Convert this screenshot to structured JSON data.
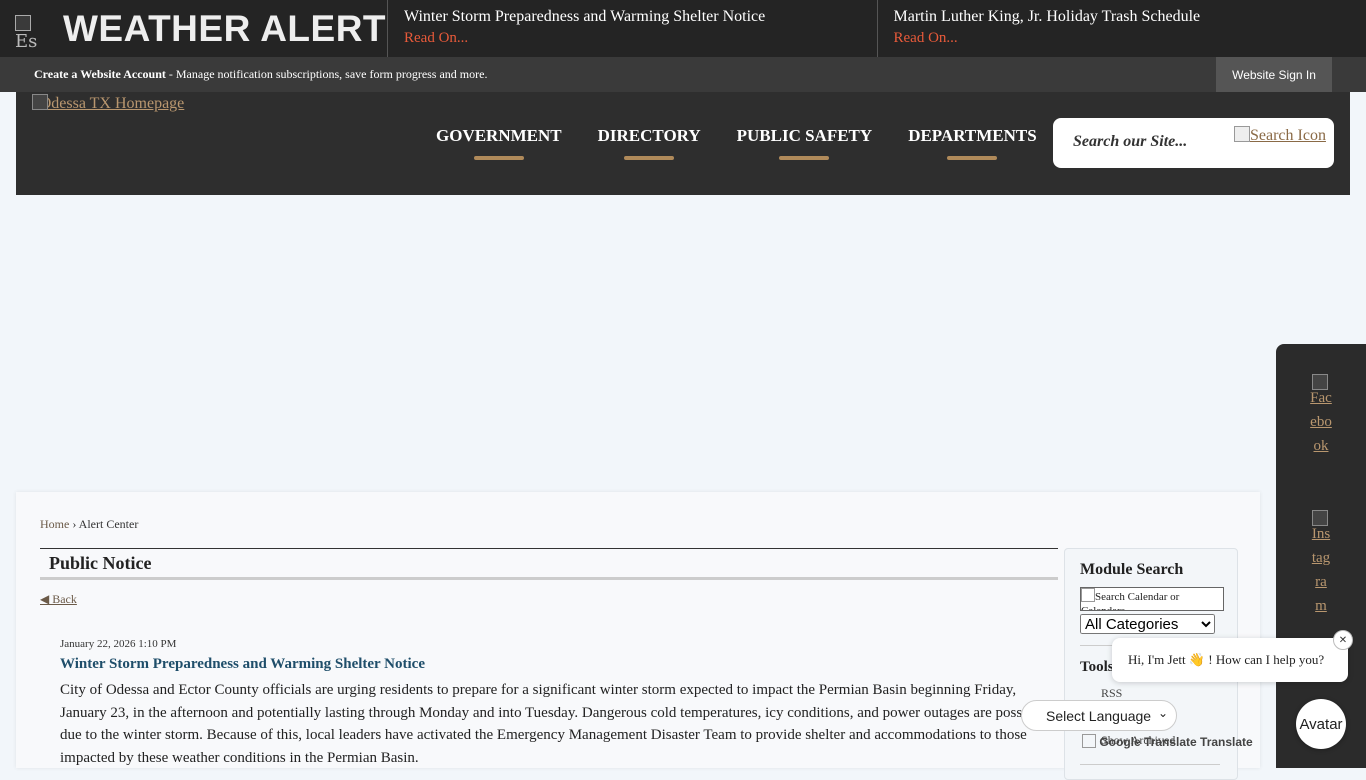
{
  "alert_bar": {
    "icon_alt": "Es",
    "title": "WEATHER ALERT",
    "items": [
      {
        "title": "Winter Storm Preparedness and Warming Shelter Notice",
        "link": "Read On..."
      },
      {
        "title": "Martin Luther King, Jr. Holiday Trash Schedule",
        "link": "Read On..."
      }
    ]
  },
  "account_bar": {
    "create_label": "Create a Website Account",
    "message": " - Manage notification subscriptions, save form progress and more.",
    "signin_label": "Website Sign In"
  },
  "header": {
    "logo_alt": "Odessa TX Homepage",
    "nav": [
      "GOVERNMENT",
      "DIRECTORY",
      "PUBLIC SAFETY",
      "DEPARTMENTS"
    ],
    "search_placeholder": "Search our Site...",
    "search_icon_alt": "Search Icon"
  },
  "social": [
    {
      "label": "Facebook",
      "icon": "facebook-icon"
    },
    {
      "label": "Instagram",
      "icon": "instagram-icon"
    }
  ],
  "breadcrumb": {
    "home": "Home",
    "separator": "›",
    "current": "Alert Center"
  },
  "section_title": "Public Notice",
  "back_label": "◀ Back",
  "post": {
    "date": "January 22, 2026 1:10 PM",
    "title": "Winter Storm Preparedness and Warming Shelter Notice",
    "body": "City of Odessa and Ector County officials are urging residents to prepare for a significant winter storm expected to impact the Permian Basin beginning Friday, January 23, in the afternoon and potentially lasting through Monday and into Tuesday. Dangerous cold temperatures, icy conditions, and power outages are possible due to the winter storm. Because of this, local leaders have activated the Emergency Management Disaster Team to provide shelter and accommodations to those impacted by these weather conditions in the Permian Basin."
  },
  "module": {
    "title": "Module Search",
    "search_placeholder": "Search Calendar or Calendars",
    "category_selected": "All Categories",
    "tools_title": "Tools",
    "rss": "RSS",
    "archived": "Show Archived"
  },
  "chat": {
    "message": "Hi, I'm Jett 👋 ! How can I help you?",
    "close": "✕",
    "avatar_label": "Avatar"
  },
  "translate": {
    "select_label": "Select Language",
    "powered": "Google Translate Translate"
  }
}
